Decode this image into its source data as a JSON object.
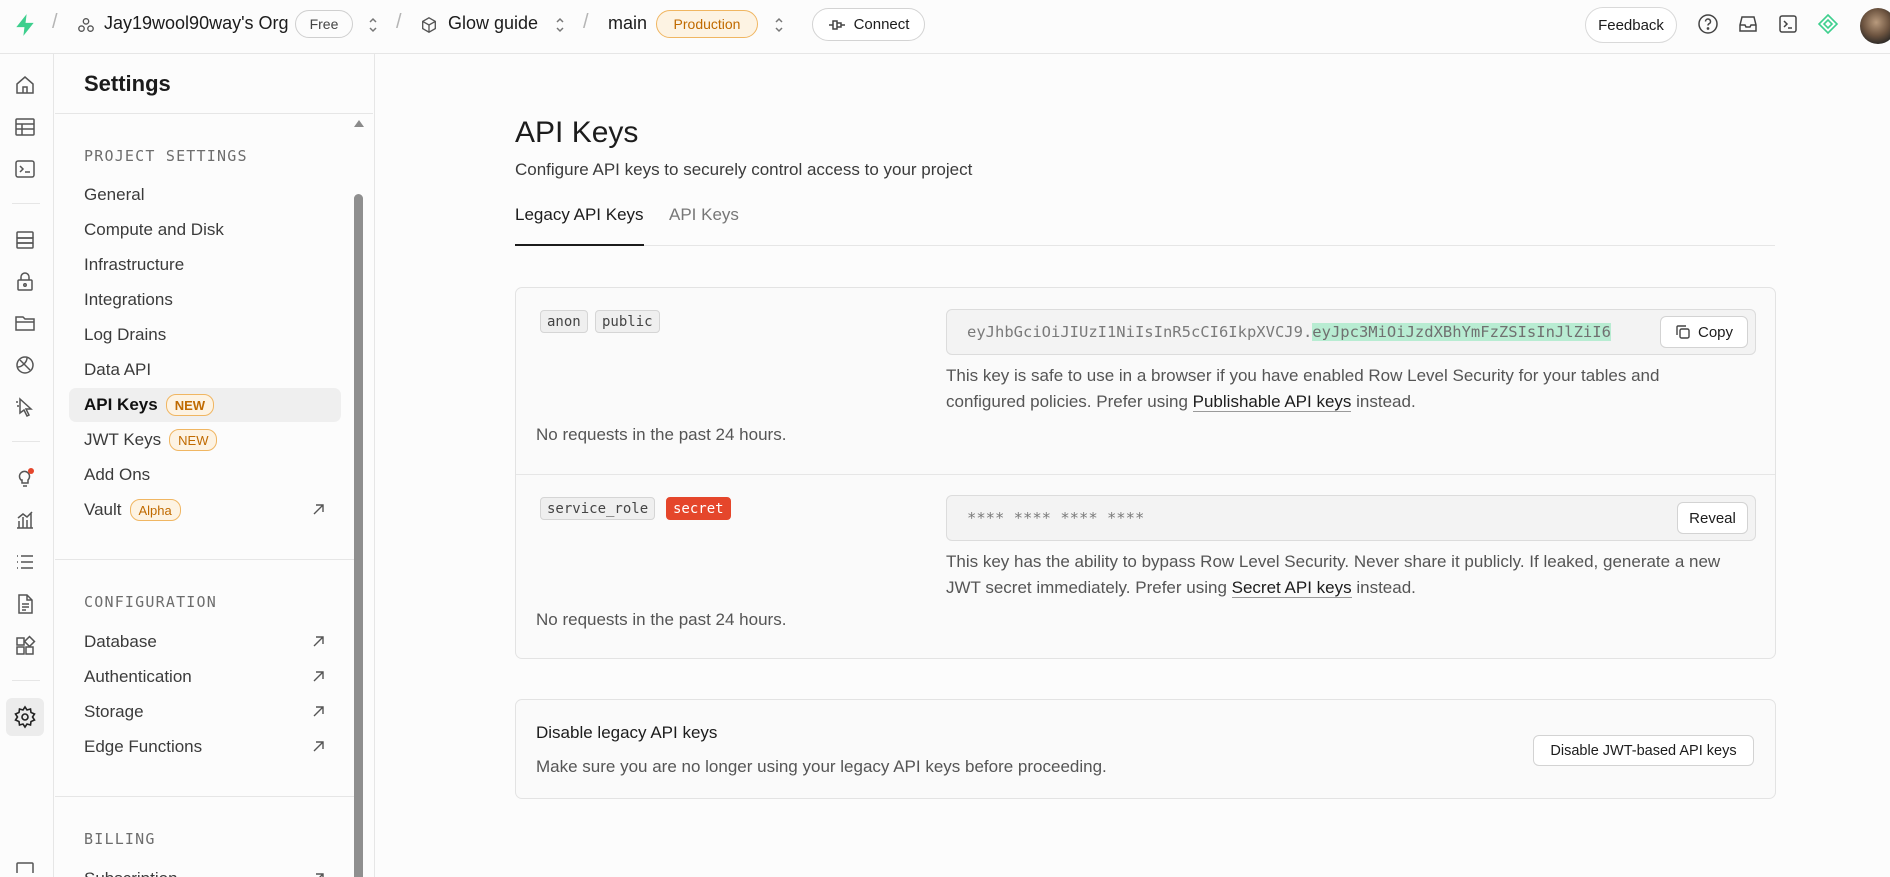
{
  "topbar": {
    "org_name": "Jay19wool90way's Org",
    "org_plan": "Free",
    "project_name": "Glow guide",
    "branch_name": "main",
    "branch_env": "Production",
    "connect_label": "Connect",
    "feedback_label": "Feedback",
    "icons": [
      "help-icon",
      "inbox-icon",
      "terminal-icon",
      "assistant-icon"
    ]
  },
  "rail": {
    "icons": [
      "home-icon",
      "table-editor-icon",
      "sql-editor-icon",
      "database-icon",
      "auth-icon",
      "storage-icon",
      "realtime-icon",
      "edge-functions-icon",
      "advisors-icon",
      "reports-icon",
      "logs-icon",
      "api-docs-icon",
      "integrations-icon",
      "settings-icon"
    ]
  },
  "sidebar": {
    "title": "Settings",
    "project_settings": {
      "heading": "PROJECT SETTINGS",
      "items": [
        {
          "label": "General"
        },
        {
          "label": "Compute and Disk"
        },
        {
          "label": "Infrastructure"
        },
        {
          "label": "Integrations"
        },
        {
          "label": "Log Drains"
        },
        {
          "label": "Data API"
        },
        {
          "label": "API Keys",
          "badge": "NEW",
          "active": true
        },
        {
          "label": "JWT Keys",
          "badge": "NEW"
        },
        {
          "label": "Add Ons"
        },
        {
          "label": "Vault",
          "badge": "Alpha",
          "external": true
        }
      ]
    },
    "configuration": {
      "heading": "CONFIGURATION",
      "items": [
        {
          "label": "Database",
          "external": true
        },
        {
          "label": "Authentication",
          "external": true
        },
        {
          "label": "Storage",
          "external": true
        },
        {
          "label": "Edge Functions",
          "external": true
        }
      ]
    },
    "billing": {
      "heading": "BILLING",
      "items": [
        {
          "label": "Subscription",
          "external": true
        }
      ]
    }
  },
  "main": {
    "title": "API Keys",
    "description": "Configure API keys to securely control access to your project",
    "tabs": [
      {
        "label": "Legacy API Keys",
        "active": true
      },
      {
        "label": "API Keys",
        "active": false
      }
    ],
    "anon_key": {
      "tags": [
        "anon",
        "public"
      ],
      "value_plain": "eyJhbGciOiJIUzI1NiIsInR5cCI6IkpXVCJ9.",
      "value_highlighted": "eyJpc3MiOiJzdXBhYmFzZSIsInJlZiI6",
      "copy_label": "Copy",
      "desc_before": "This key is safe to use in a browser if you have enabled Row Level Security for your tables and configured policies. Prefer using ",
      "desc_link": "Publishable API keys",
      "desc_after": " instead.",
      "requests": "No requests in the past 24 hours."
    },
    "service_key": {
      "tags": [
        "service_role",
        "secret"
      ],
      "masked_value": "**** **** **** ****",
      "reveal_label": "Reveal",
      "desc_before": "This key has the ability to bypass Row Level Security. Never share it publicly. If leaked, generate a new JWT secret immediately. Prefer using ",
      "desc_link": "Secret API keys",
      "desc_after": " instead.",
      "requests": "No requests in the past 24 hours."
    },
    "disable_legacy": {
      "title": "Disable legacy API keys",
      "description": "Make sure you are no longer using your legacy API keys before proceeding.",
      "button_label": "Disable JWT-based API keys"
    }
  },
  "colors": {
    "brand": "#3ecf8e",
    "badge_orange": "#c06a00",
    "secret_red": "#e5462b",
    "highlight_green": "#b8ecd2"
  }
}
